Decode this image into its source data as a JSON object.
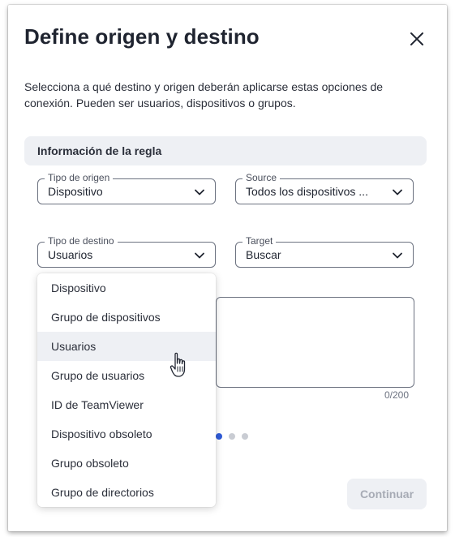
{
  "dialog": {
    "title": "Define origen y destino",
    "description": "Selecciona a qué destino y origen deberán aplicarse estas opciones de conexión. Pueden ser usuarios, dispositivos o grupos.",
    "section_title": "Información de la regla"
  },
  "fields": {
    "origin_type": {
      "legend": "Tipo de origen",
      "value": "Dispositivo"
    },
    "source": {
      "legend": "Source",
      "value": "Todos los dispositivos ..."
    },
    "destination_type": {
      "legend": "Tipo de destino",
      "value": "Usuarios"
    },
    "target": {
      "legend": "Target",
      "value": "Buscar"
    }
  },
  "comment": {
    "counter": "0/200"
  },
  "dropdown": {
    "items": [
      "Dispositivo",
      "Grupo de dispositivos",
      "Usuarios",
      "Grupo de usuarios",
      "ID de TeamViewer",
      "Dispositivo obsoleto",
      "Grupo obsoleto",
      "Grupo de directorios"
    ],
    "hovered": "Usuarios"
  },
  "stepper": {
    "active_step": 1,
    "total_steps": 3
  },
  "footer": {
    "continue_label": "Continuar"
  },
  "colors": {
    "accent": "#2f5bd8",
    "dot_inactive": "#c9ccd3",
    "section_bg": "#eef0f4"
  },
  "icons": {
    "close": "close-icon",
    "chevron": "chevron-down-icon",
    "cursor": "hand-pointer-icon"
  }
}
